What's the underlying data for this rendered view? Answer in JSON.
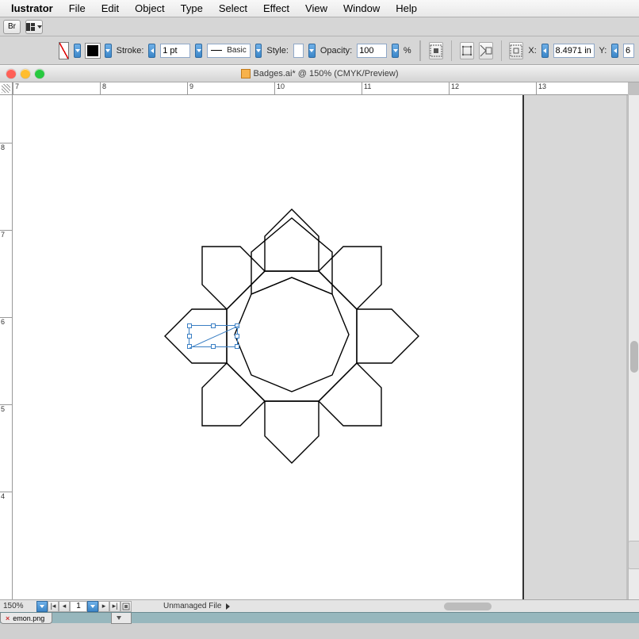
{
  "menubar": {
    "app": "lustrator",
    "items": [
      "File",
      "Edit",
      "Object",
      "Type",
      "Select",
      "Effect",
      "View",
      "Window",
      "Help"
    ]
  },
  "row2": {
    "br_label": "Br"
  },
  "controlbar": {
    "stroke_label": "Stroke:",
    "stroke_value": "1 pt",
    "brush_name": "Basic",
    "style_label": "Style:",
    "opacity_label": "Opacity:",
    "opacity_value": "100",
    "opacity_unit": "%",
    "x_label": "X:",
    "x_value": "8.4971 in",
    "y_label": "Y:",
    "y_value": "6"
  },
  "titlebar": {
    "text": "Badges.ai* @ 150% (CMYK/Preview)"
  },
  "ruler_h": {
    "ticks": [
      "7",
      "8",
      "9",
      "10",
      "11",
      "12",
      "13"
    ]
  },
  "ruler_v": {
    "ticks": [
      "8",
      "7",
      "6",
      "5",
      "4"
    ]
  },
  "statusbar": {
    "zoom": "150%",
    "artboard_num": "1",
    "unmanaged": "Unmanaged File"
  },
  "bottom": {
    "tab_label": "emon.png"
  },
  "chart_data": null
}
